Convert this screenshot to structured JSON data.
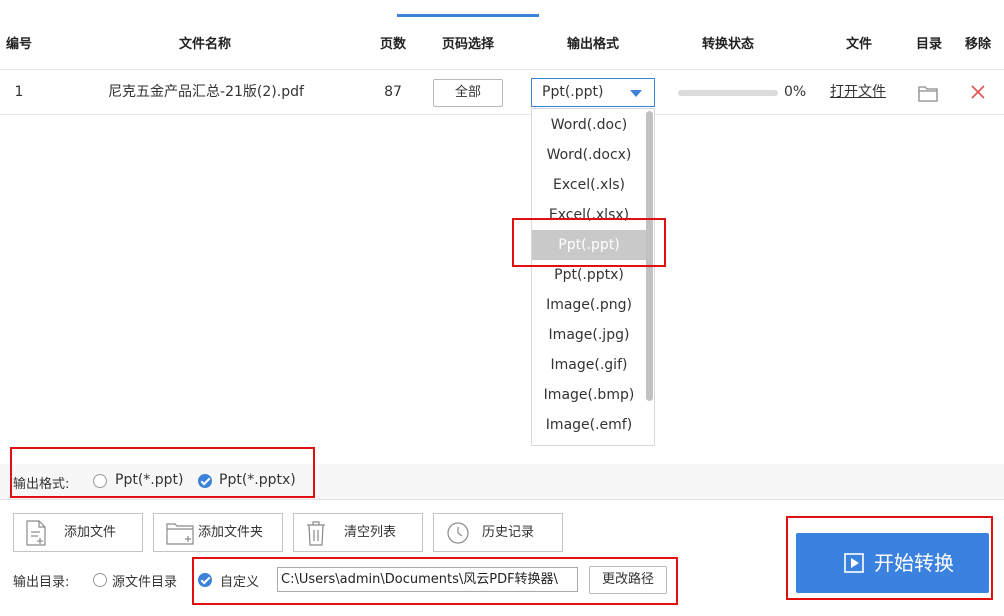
{
  "table": {
    "headers": {
      "index": "编号",
      "filename": "文件名称",
      "pages": "页数",
      "page_select": "页码选择",
      "output_format": "输出格式",
      "status": "转换状态",
      "file": "文件",
      "directory": "目录",
      "remove": "移除"
    },
    "rows": [
      {
        "index": "1",
        "filename": "尼克五金产品汇总-21版(2).pdf",
        "pages": "87",
        "page_select": "全部",
        "format": "Ppt(.ppt)",
        "progress": 0,
        "progress_text": "0%",
        "file_action": "打开文件"
      }
    ]
  },
  "dropdown": {
    "options": [
      "Word(.doc)",
      "Word(.docx)",
      "Excel(.xls)",
      "Excel(.xlsx)",
      "Ppt(.ppt)",
      "Ppt(.pptx)",
      "Image(.png)",
      "Image(.jpg)",
      "Image(.gif)",
      "Image(.bmp)",
      "Image(.emf)"
    ],
    "selected": "Ppt(.ppt)"
  },
  "format_bar": {
    "label": "输出格式:",
    "options": [
      {
        "label": "Ppt(*.ppt)",
        "checked": false
      },
      {
        "label": "Ppt(*.pptx)",
        "checked": true
      }
    ]
  },
  "toolbar": {
    "add_file": "添加文件",
    "add_folder": "添加文件夹",
    "clear_list": "清空列表",
    "history": "历史记录"
  },
  "output_dir": {
    "label": "输出目录:",
    "source_option": "源文件目录",
    "custom_option": "自定义",
    "path": "C:\\Users\\admin\\Documents\\风云PDF转换器\\",
    "change_button": "更改路径"
  },
  "start_button": "开始转换",
  "colors": {
    "accent": "#3b82d8",
    "start_button": "#3b82e0",
    "highlight_box": "#e01010",
    "remove_icon": "#e05050"
  }
}
